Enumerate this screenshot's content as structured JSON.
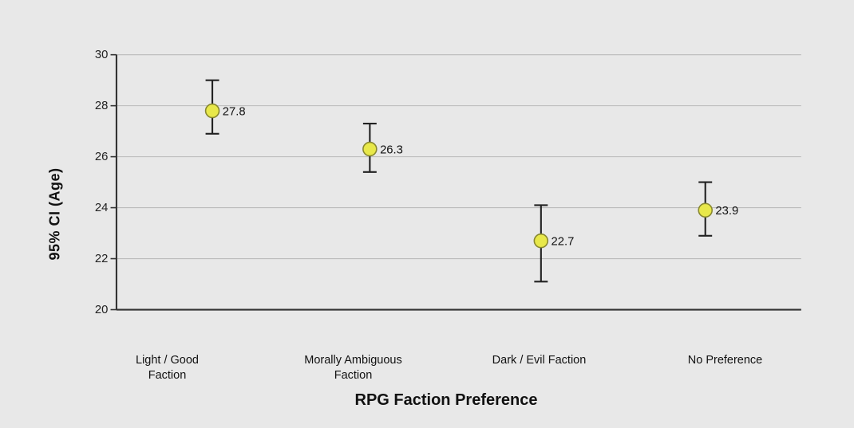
{
  "chart": {
    "title": "RPG Faction Preference",
    "y_axis_label": "95% CI (Age)",
    "y_min": 20,
    "y_max": 30,
    "y_ticks": [
      20,
      22,
      24,
      26,
      28,
      30
    ],
    "grid_lines": [
      20,
      22,
      24,
      26,
      28,
      30
    ],
    "x_labels": [
      "Light / Good\nFaction",
      "Morally Ambiguous\nFaction",
      "Dark / Evil Faction",
      "No Preference"
    ],
    "data_points": [
      {
        "label": "Light / Good Faction",
        "mean": 27.8,
        "ci_low": 26.9,
        "ci_high": 29.0,
        "x_pos": 0.14
      },
      {
        "label": "Morally Ambiguous Faction",
        "mean": 26.3,
        "ci_low": 25.4,
        "ci_high": 27.3,
        "x_pos": 0.37
      },
      {
        "label": "Dark / Evil Faction",
        "mean": 22.7,
        "ci_low": 21.1,
        "ci_high": 24.1,
        "x_pos": 0.62
      },
      {
        "label": "No Preference",
        "mean": 23.9,
        "ci_low": 22.9,
        "ci_high": 25.0,
        "x_pos": 0.86
      }
    ],
    "point_color": "#e8e84a",
    "point_stroke": "#888830",
    "error_bar_color": "#222",
    "accent_color": "#333"
  }
}
